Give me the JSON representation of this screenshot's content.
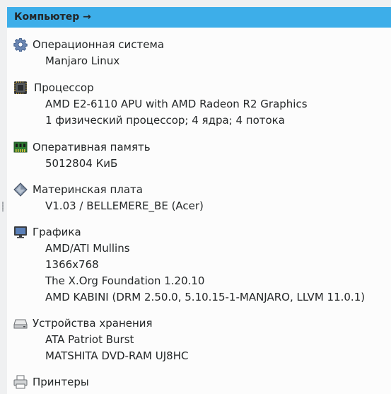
{
  "header": {
    "title": "Компьютер →"
  },
  "sections": [
    {
      "title": "Операционная система",
      "icon": "gear-icon",
      "values": [
        "Manjaro Linux"
      ]
    },
    {
      "title": "Процессор",
      "icon": "cpu-chip-icon",
      "values": [
        "AMD E2-6110 APU with AMD Radeon R2 Graphics",
        "1 физический процессор; 4 ядра; 4 потока"
      ]
    },
    {
      "title": "Оперативная память",
      "icon": "memory-module-icon",
      "values": [
        "5012804 КиБ"
      ]
    },
    {
      "title": "Материнская плата",
      "icon": "motherboard-diamond-icon",
      "values": [
        "V1.03 / BELLEMERE_BE (Acer)"
      ]
    },
    {
      "title": "Графика",
      "icon": "monitor-icon",
      "values": [
        "AMD/ATI Mullins",
        "1366x768",
        "The X.Org Foundation 1.20.10",
        "AMD KABINI (DRM 2.50.0, 5.10.15-1-MANJARO, LLVM 11.0.1)"
      ]
    },
    {
      "title": "Устройства хранения",
      "icon": "hard-drive-icon",
      "values": [
        "ATA Patriot Burst",
        "MATSHITA DVD-RAM UJ8HC"
      ]
    },
    {
      "title": "Принтеры",
      "icon": "printer-icon",
      "values": []
    }
  ],
  "colors": {
    "header_background": "#3daee9",
    "panel_background": "#fcfcfc",
    "text": "#232627"
  }
}
